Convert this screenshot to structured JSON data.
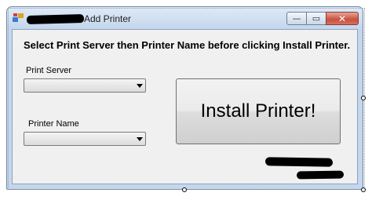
{
  "window": {
    "title": "Add Printer",
    "caption_buttons": {
      "minimize": "—",
      "maximize": "▭",
      "close": "✕"
    }
  },
  "form": {
    "instruction": "Select Print Server then Printer Name before clicking Install Printer.",
    "print_server_label": "Print Server",
    "print_server_value": "",
    "printer_name_label": "Printer Name",
    "printer_name_value": "",
    "install_button_label": "Install Printer!"
  },
  "colors": {
    "title_bar": "#c4d6ec",
    "client_bg": "#f0f0f0",
    "close_button": "#c9503b"
  }
}
